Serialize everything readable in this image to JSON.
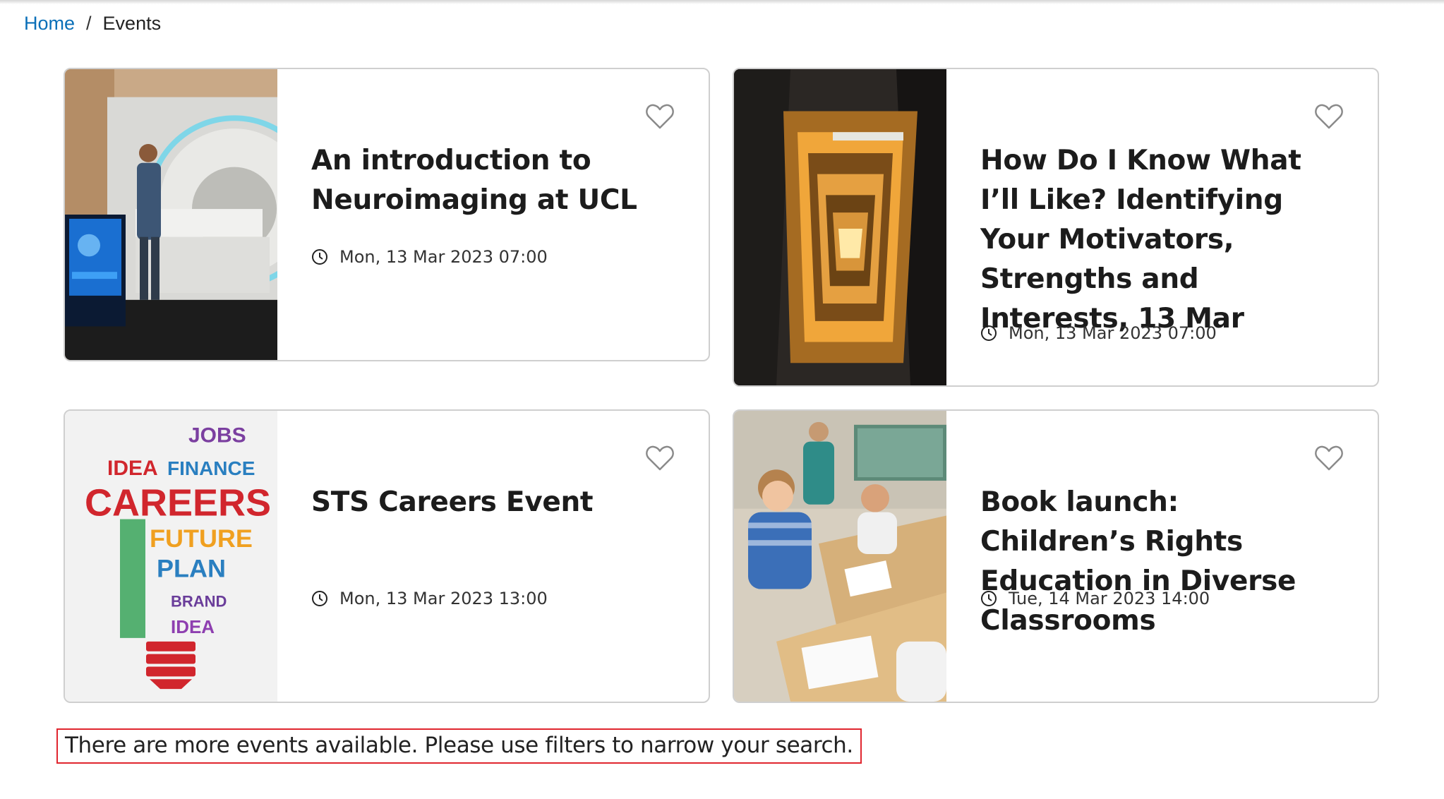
{
  "breadcrumb": {
    "home": "Home",
    "separator": "/",
    "current": "Events"
  },
  "events": [
    {
      "title": "An introduction to Neuroimaging at UCL",
      "date": "Mon, 13 Mar 2023 07:00",
      "image": "mri-scanner-photo"
    },
    {
      "title": "How Do I Know What I’ll Like? Identifying Your Motivators, Strengths and Interests, 13 Mar",
      "date": "Mon, 13 Mar 2023 07:00",
      "image": "spiral-staircase-photo"
    },
    {
      "title": "STS Careers Event",
      "date": "Mon, 13 Mar 2023 13:00",
      "image": "careers-lightbulb-wordcloud"
    },
    {
      "title": "Book launch: Children’s Rights Education in Diverse Classrooms",
      "date": "Tue, 14 Mar 2023 14:00",
      "image": "classroom-children-photo"
    }
  ],
  "careers_image_words": [
    "JOBS",
    "IDEA",
    "FINANCE",
    "CAREERS",
    "FUTURE",
    "PLAN",
    "BRAND",
    "IDEA"
  ],
  "notice": "There are more events available. Please use filters to narrow your search.",
  "colors": {
    "link": "#0a6fb8",
    "notice_border": "#e0262f",
    "card_border": "#cfcfcf"
  },
  "icons": {
    "favorite": "heart-outline-icon",
    "time": "clock-icon"
  }
}
